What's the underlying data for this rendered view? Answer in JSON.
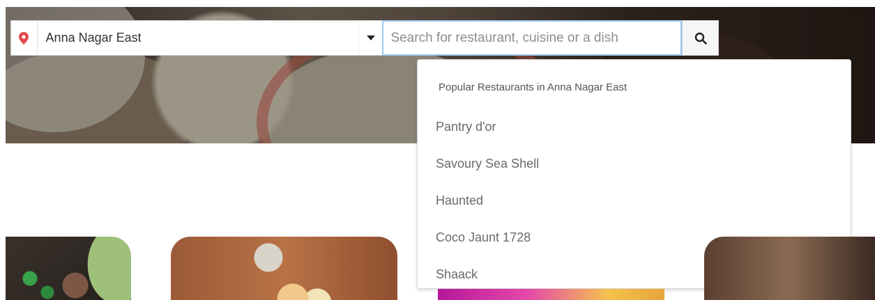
{
  "search": {
    "location": "Anna Nagar East",
    "placeholder": "Search for restaurant, cuisine or a dish",
    "value": ""
  },
  "icons": {
    "location": "location-pin-icon",
    "dropdown": "caret-down-icon",
    "search": "search-icon"
  },
  "dropdown": {
    "title": "Popular Restaurants in Anna Nagar East",
    "items": [
      "Pantry d'or",
      "Savoury Sea Shell",
      "Haunted",
      "Coco Jaunt 1728",
      "Shaack"
    ]
  },
  "colors": {
    "pin": "#e04b4b",
    "focus_border": "#9cc5f2"
  }
}
